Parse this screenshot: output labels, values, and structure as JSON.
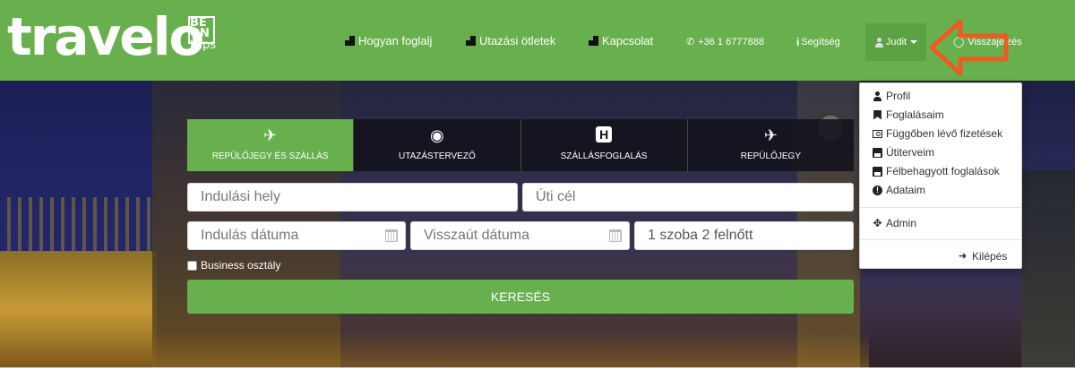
{
  "header": {
    "logo": "travelo",
    "brand": {
      "line1": "BE",
      "line2": "ON",
      "line3": "trips"
    },
    "nav": [
      {
        "label": "Hogyan foglalj"
      },
      {
        "label": "Utazási ötletek"
      },
      {
        "label": "Kapcsolat"
      },
      {
        "label": "+36 1 6777888"
      },
      {
        "label": "Segítség"
      }
    ],
    "user_button": "Judit",
    "partial_link": "Visszajelzés"
  },
  "search": {
    "tabs": [
      {
        "label": "REPÜLŐJEGY ÉS SZÁLLÁS",
        "active": true,
        "icon": "plane-hotel-icon"
      },
      {
        "label": "UTAZÁSTERVEZŐ",
        "active": false,
        "icon": "map-pins-icon"
      },
      {
        "label": "SZÁLLÁSFOGLALÁS",
        "active": false,
        "icon": "hotel-h-icon"
      },
      {
        "label": "REPÜLŐJEGY",
        "active": false,
        "icon": "plane-icon"
      }
    ],
    "from_placeholder": "Indulási hely",
    "to_placeholder": "Úti cél",
    "depart_placeholder": "Indulás dátuma",
    "return_placeholder": "Visszaút dátuma",
    "rooms_value": "1 szoba 2 felnőtt",
    "business_label": "Business osztály",
    "search_button": "KERESÉS"
  },
  "dropdown": {
    "items": [
      {
        "label": "Profil",
        "icon": "user-icon"
      },
      {
        "label": "Foglalásaim",
        "icon": "bookmark-icon"
      },
      {
        "label": "Függőben lévő fizetések",
        "icon": "money-icon"
      },
      {
        "label": "Útiterveim",
        "icon": "save-icon"
      },
      {
        "label": "Félbehagyott foglalások",
        "icon": "save-icon"
      },
      {
        "label": "Adataim",
        "icon": "info-icon"
      }
    ],
    "admin": "Admin",
    "logout": "Kilépés"
  },
  "colors": {
    "brand_green": "#67b04d",
    "dark_tab": "#12121c",
    "annotation_arrow": "#f05a22"
  }
}
